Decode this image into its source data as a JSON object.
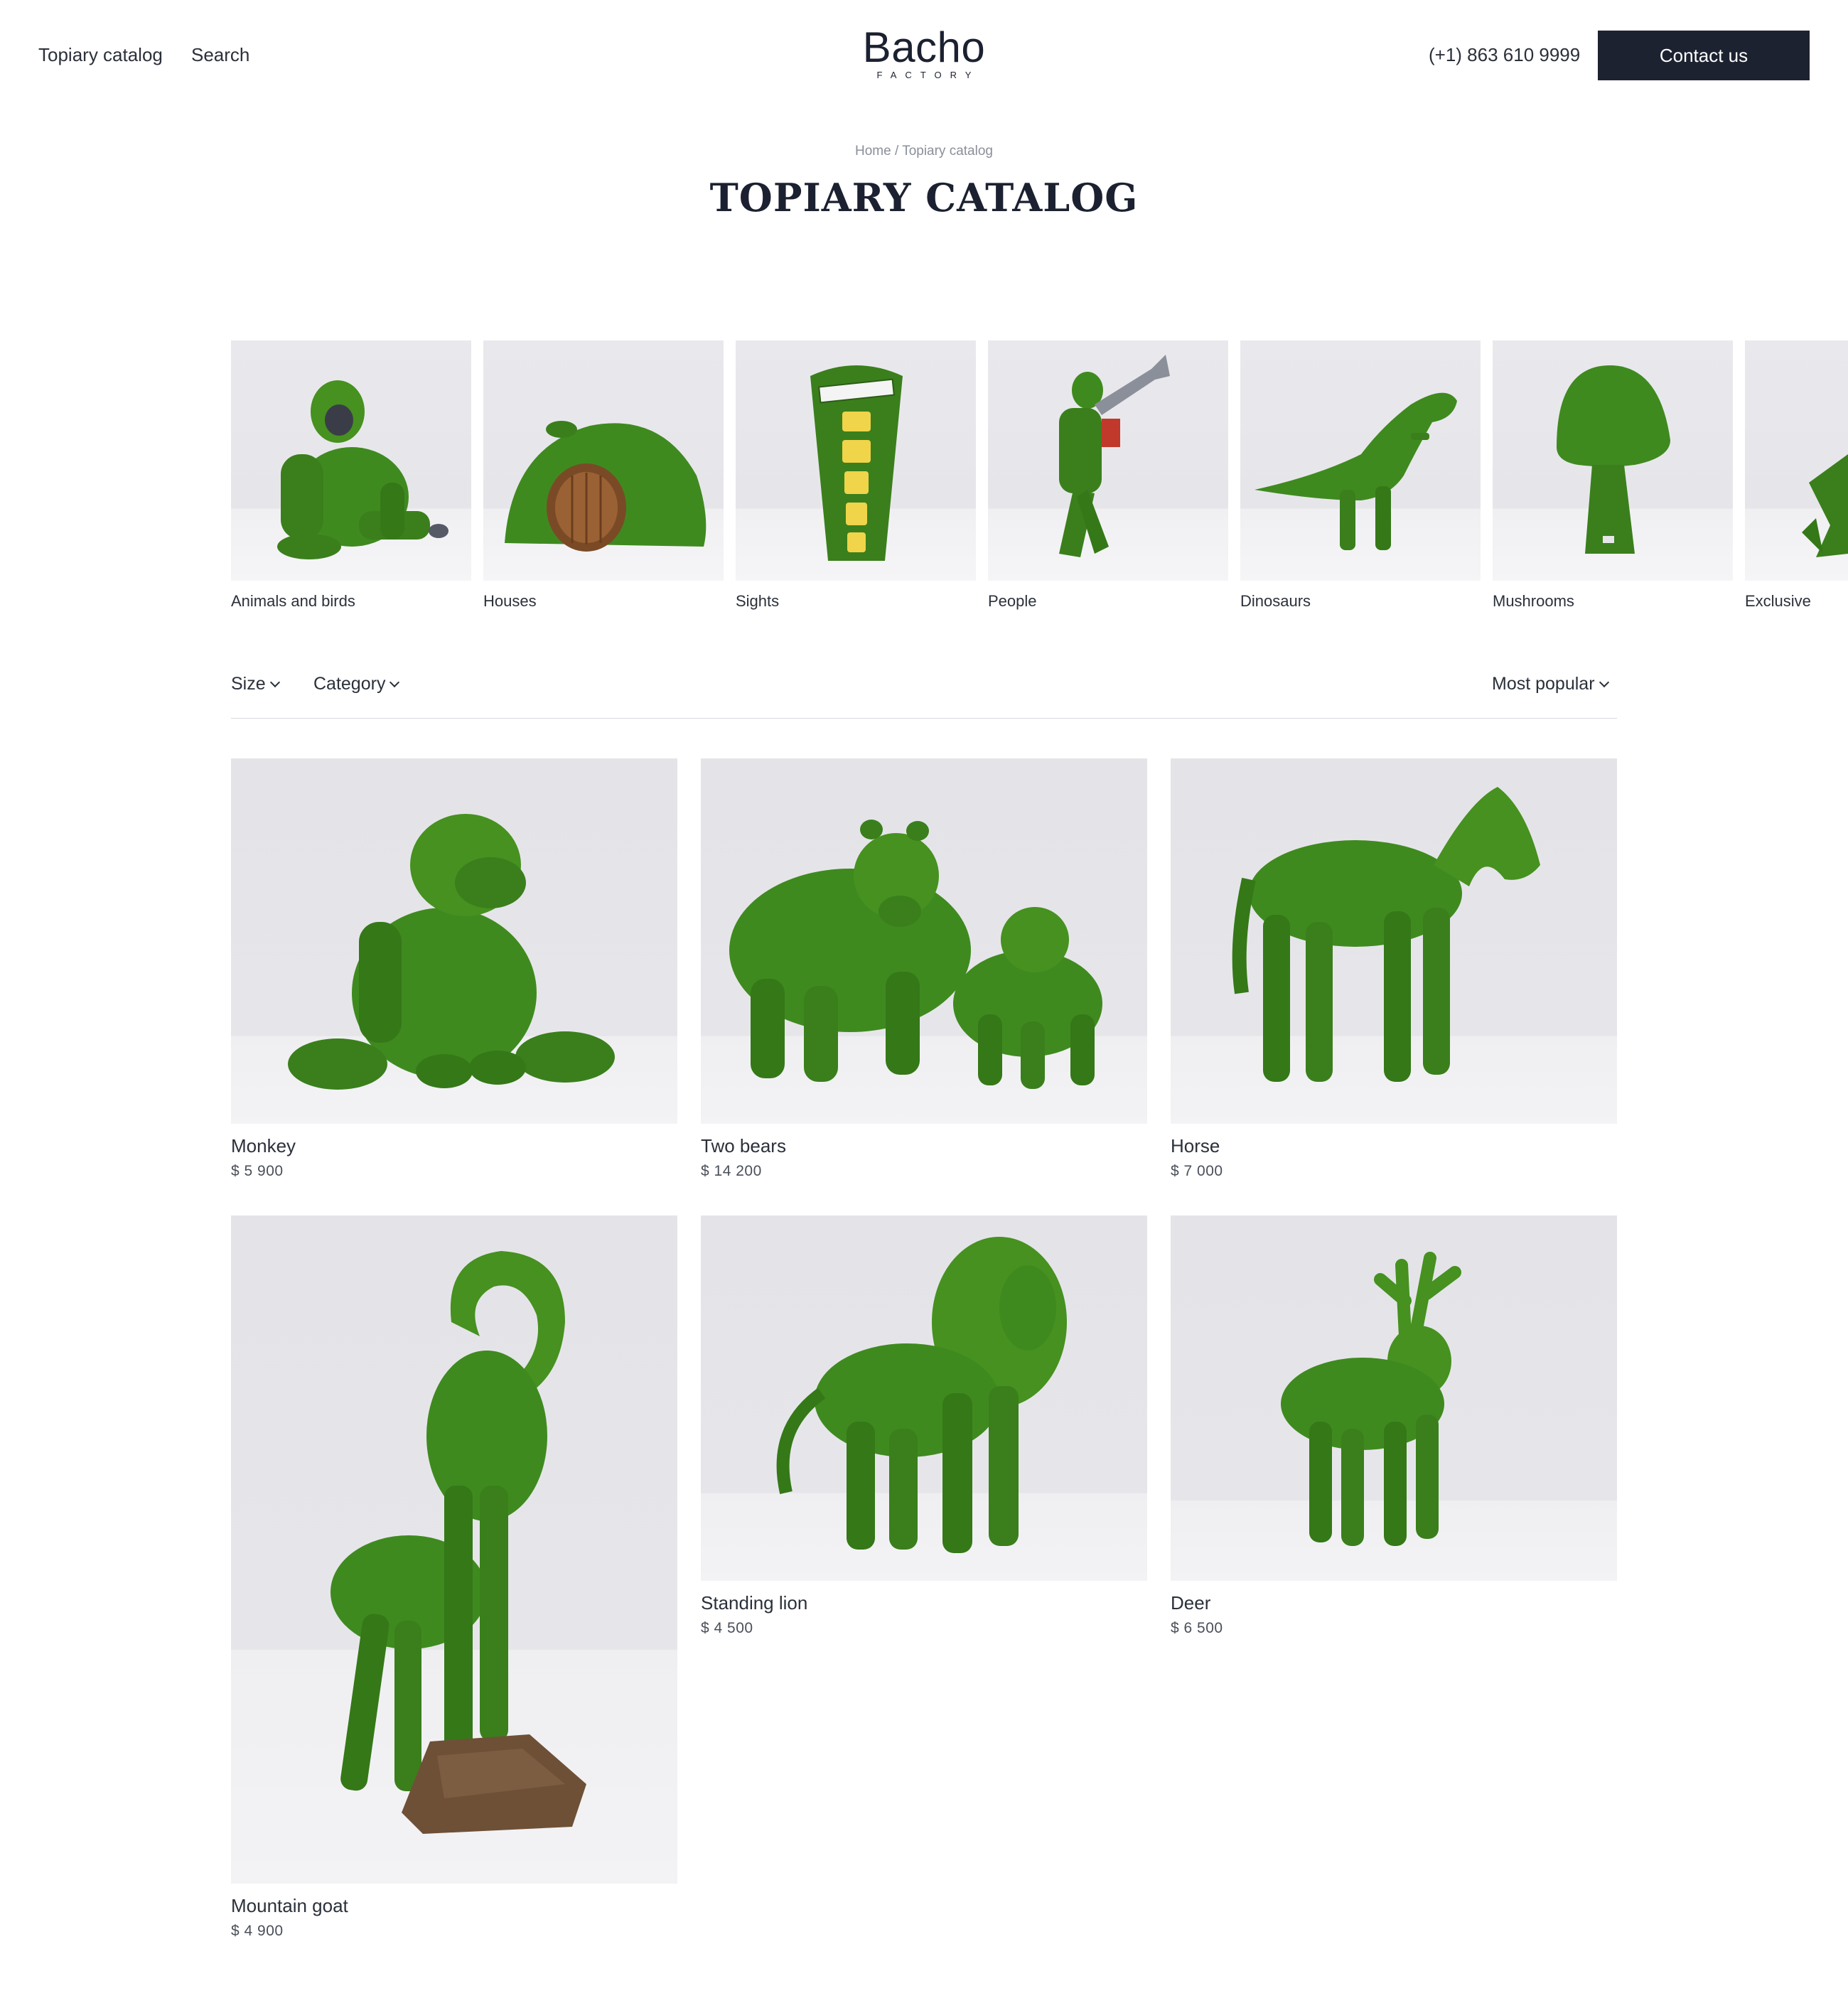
{
  "header": {
    "nav": [
      "Topiary catalog",
      "Search"
    ],
    "logo_main": "Bacho",
    "logo_sub": "FACTORY",
    "phone": "(+1) 863 610 9999",
    "contact_label": "Contact us"
  },
  "breadcrumb": {
    "home": "Home",
    "separator": "/",
    "current": "Topiary catalog"
  },
  "page_title": "TOPIARY CATALOG",
  "categories": [
    {
      "label": "Animals and birds",
      "icon": "gorilla-topiary"
    },
    {
      "label": "Houses",
      "icon": "house-topiary"
    },
    {
      "label": "Sights",
      "icon": "telephone-booth-topiary"
    },
    {
      "label": "People",
      "icon": "trumpeter-topiary"
    },
    {
      "label": "Dinosaurs",
      "icon": "t-rex-topiary"
    },
    {
      "label": "Mushrooms",
      "icon": "mushroom-topiary"
    },
    {
      "label": "Exclusive",
      "icon": "exclusive-topiary"
    }
  ],
  "filters": {
    "size": "Size",
    "category": "Category",
    "sort": "Most popular"
  },
  "products": [
    {
      "name": "Monkey",
      "price": "$ 5 900"
    },
    {
      "name": "Two bears",
      "price": "$ 14 200"
    },
    {
      "name": "Horse",
      "price": "$ 7 000"
    },
    {
      "name": "Mountain goat",
      "price": "$ 4 900"
    },
    {
      "name": "Standing lion",
      "price": "$ 4 500"
    },
    {
      "name": "Deer",
      "price": "$ 6 500"
    }
  ],
  "colors": {
    "accent_dark": "#1d2230",
    "moss_green": "#3f8a1f",
    "background": "#ffffff"
  }
}
